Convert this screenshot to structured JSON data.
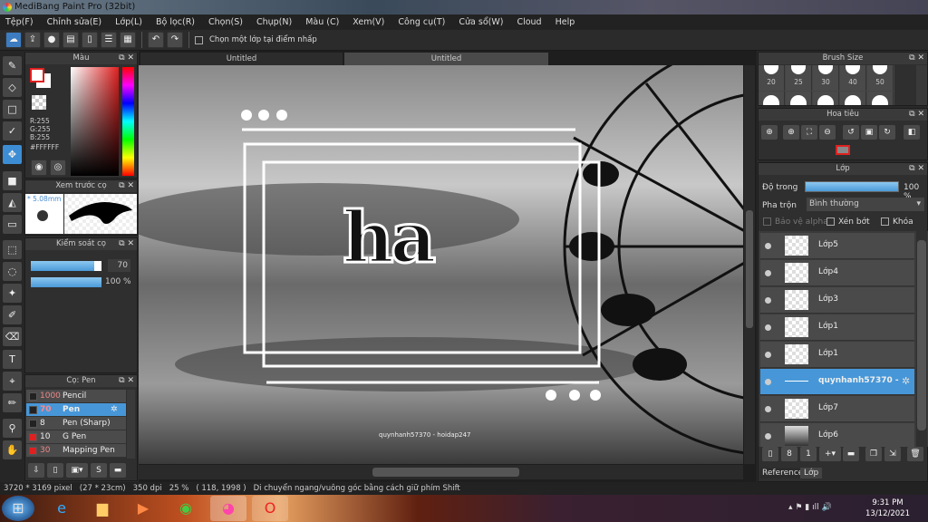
{
  "window": {
    "title": "MediBang Paint Pro (32bit)"
  },
  "menu": [
    "Tệp(F)",
    "Chỉnh sửa(E)",
    "Lớp(L)",
    "Bộ lọc(R)",
    "Chọn(S)",
    "Chụp(N)",
    "Màu (C)",
    "Xem(V)",
    "Công cụ(T)",
    "Cửa sổ(W)",
    "Cloud",
    "Help"
  ],
  "toolbar": {
    "select_layer_label": "Chọn một lớp tại điểm nhấp"
  },
  "tabs": [
    "Untitled",
    "Untitled"
  ],
  "color_panel": {
    "title": "Màu",
    "r": "R:255",
    "g": "G:255",
    "b": "B:255",
    "hex": "#FFFFFF",
    "primary": "#FFFFFF",
    "accent": "#E02020"
  },
  "brush_preview": {
    "title": "Xem trước cọ",
    "size": "* 5.08mm"
  },
  "brush_control": {
    "title": "Kiểm soát cọ",
    "size_value": "70",
    "size_fraction": 0.9,
    "opacity_value": "100 %",
    "opacity_fraction": 1.0
  },
  "brush_list": {
    "title": "Cọ: Pen",
    "items": [
      {
        "size": "1000",
        "name": "Pencil",
        "color": "#222222",
        "size_color": "#e88"
      },
      {
        "size": "70",
        "name": "Pen",
        "color": "#222222",
        "size_color": "#f88",
        "selected": true
      },
      {
        "size": "8",
        "name": "Pen (Sharp)",
        "color": "#222222",
        "size_color": "#eee"
      },
      {
        "size": "10",
        "name": "G Pen",
        "color": "#e02020",
        "size_color": "#eee"
      },
      {
        "size": "30",
        "name": "Mapping Pen",
        "color": "#e02020",
        "size_color": "#e88"
      }
    ]
  },
  "brush_size": {
    "title": "Brush Size",
    "sizes": [
      "20",
      "25",
      "30",
      "40",
      "50"
    ]
  },
  "navigator": {
    "title": "Hoa tiêu"
  },
  "layers": {
    "title": "Lớp",
    "opacity_label": "Độ trong",
    "opacity_value": "100 %",
    "blend_label": "Pha trộn",
    "blend_value": "Bình thường",
    "protect_alpha": "Bảo vệ alpha",
    "clipping": "Xén bớt",
    "lock": "Khóa",
    "items": [
      {
        "name": "Lớp5"
      },
      {
        "name": "Lớp4"
      },
      {
        "name": "Lớp3"
      },
      {
        "name": "Lớp1"
      },
      {
        "name": "Lớp1"
      },
      {
        "name": "quynhanh57370 - ",
        "selected": true
      },
      {
        "name": "Lớp7"
      },
      {
        "name": "Lớp6"
      }
    ],
    "tabs": [
      "Reference",
      "Lớp"
    ]
  },
  "canvas": {
    "art_text": "ha",
    "watermark": "quynhanh57370 - hoidap247"
  },
  "status": {
    "dimensions": "3720 * 3169 pixel",
    "physical": "(27 * 23cm)",
    "dpi": "350 dpi",
    "zoom": "25 %",
    "coords": "( 118, 1998 )",
    "hint": "Di chuyển ngang/vuông góc bằng cách giữ phím Shift"
  },
  "taskbar": {
    "time": "9:31 PM",
    "date": "13/12/2021"
  }
}
